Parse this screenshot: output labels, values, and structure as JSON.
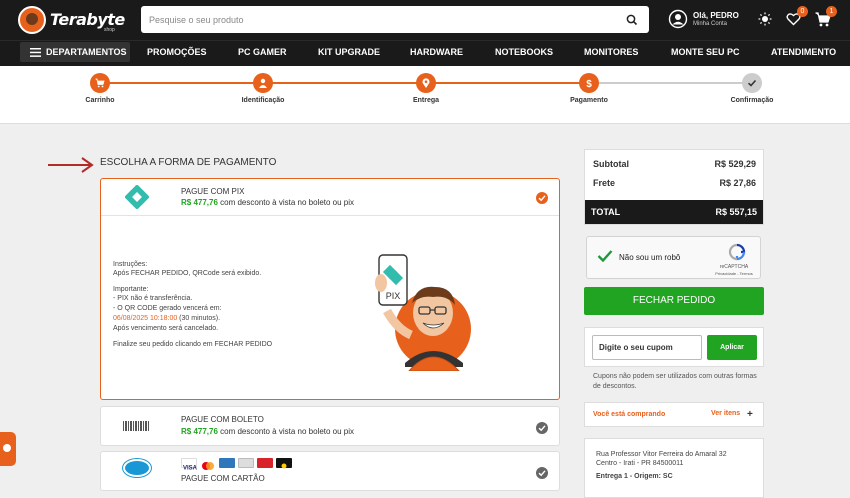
{
  "brand": {
    "name": "Terabyte",
    "tagline": "shop"
  },
  "search": {
    "placeholder": "Pesquise o seu produto",
    "value": ""
  },
  "user": {
    "greeting": "Olá, PEDRO",
    "account": "Minha Conta"
  },
  "badges": {
    "wishlist": "0",
    "cart": "1"
  },
  "nav": {
    "departments": "DEPARTAMENTOS",
    "items": [
      "PROMOÇÕES",
      "PC GAMER",
      "KIT UPGRADE",
      "HARDWARE",
      "NOTEBOOKS",
      "MONITORES",
      "MONTE SEU PC",
      "ATENDIMENTO"
    ]
  },
  "steps": [
    "Carrinho",
    "Identificação",
    "Entrega",
    "Pagamento",
    "Confirmação"
  ],
  "payment": {
    "title": "ESCOLHA A FORMA DE PAGAMENTO",
    "pix": {
      "name": "PAGUE COM PIX",
      "price": "R$ 477,76",
      "desc": " com desconto à vista no boleto ou pix",
      "instructions_title": "Instruções:",
      "instructions_line": "Após FECHAR PEDIDO, QRCode será exibido.",
      "important_title": "Importante:",
      "important_1": "- PIX não é transferência.",
      "important_2": "- O QR CODE gerado vencerá em:",
      "expiry_date": "06/08/2025 10:18:00",
      "expiry_duration": " (30 minutos).",
      "important_3": "Após vencimento será cancelado.",
      "finalize": "Finalize seu pedido clicando em FECHAR PEDIDO",
      "mascot_sign": "PIX"
    },
    "boleto": {
      "name": "PAGUE COM BOLETO",
      "price": "R$ 477,76",
      "desc": " com desconto à vista no boleto ou pix"
    },
    "card": {
      "name": "PAGUE COM CARTÃO"
    }
  },
  "summary": {
    "subtotal_label": "Subtotal",
    "subtotal": "R$ 529,29",
    "frete_label": "Frete",
    "frete": "R$ 27,86",
    "total_label": "TOTAL",
    "total": "R$ 557,15"
  },
  "captcha": {
    "label": "Não sou um robô",
    "brand": "reCAPTCHA",
    "links": "Privacidade - Termos"
  },
  "close_order": "FECHAR PEDIDO",
  "coupon": {
    "placeholder": "Digite o seu cupom",
    "button": "Aplicar",
    "note": "Cupons não podem ser utilizados com outras formas de descontos."
  },
  "buying": {
    "label": "Você está comprando",
    "link": "Ver itens"
  },
  "address": {
    "line1": "Rua Professor Vitor Ferreira do Amaral 32",
    "line2": "Centro - Irati - PR 84500011",
    "line3": "Entrega 1 - Origem: SC"
  },
  "colors": {
    "accent": "#e8611c",
    "green": "#21a421",
    "dark": "#1a1a1a",
    "pix": "#32bcad"
  }
}
